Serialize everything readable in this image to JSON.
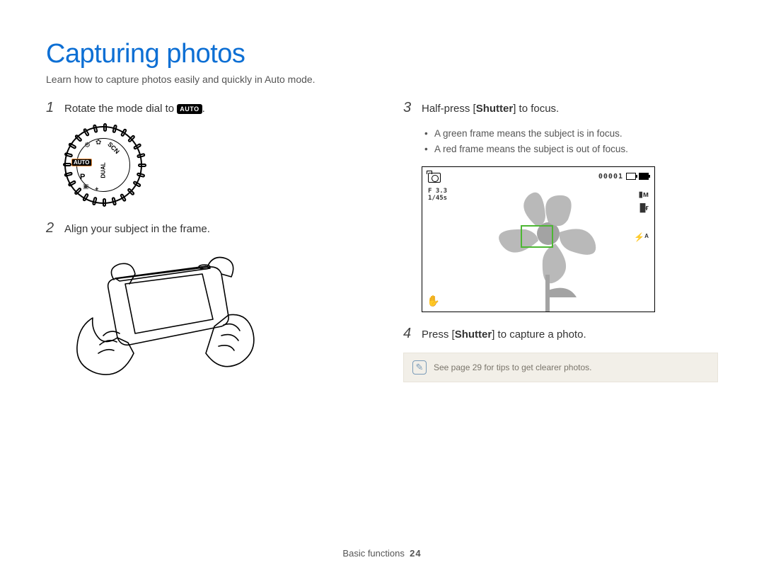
{
  "title": "Capturing photos",
  "subtitle": "Learn how to capture photos easily and quickly in Auto mode.",
  "steps": {
    "s1": {
      "num": "1",
      "text_before": "Rotate the mode dial to ",
      "badge": "AUTO",
      "text_after": "."
    },
    "s2": {
      "num": "2",
      "text": "Align your subject in the frame."
    },
    "s3": {
      "num": "3",
      "text_before": "Half-press [",
      "bold": "Shutter",
      "text_after": "] to focus."
    },
    "s3_bullets": [
      "A green frame means the subject is in focus.",
      "A red frame means the subject is out of focus."
    ],
    "s4": {
      "num": "4",
      "text_before": "Press [",
      "bold": "Shutter",
      "text_after": "] to capture a photo."
    }
  },
  "dial": {
    "auto": "AUTO",
    "dual": "DUAL",
    "p": "P",
    "scn": "SCN"
  },
  "screen": {
    "counter": "00001",
    "aperture": "F 3.3",
    "shutter": "1/45s",
    "m_icon": "▮ᴍ",
    "mf_icon": "█ғ",
    "flash_icon": "⚡ᴬ",
    "is_icon": "✋"
  },
  "tip": {
    "text": "See page 29 for tips to get clearer photos."
  },
  "footer": {
    "section": "Basic functions",
    "page": "24"
  }
}
